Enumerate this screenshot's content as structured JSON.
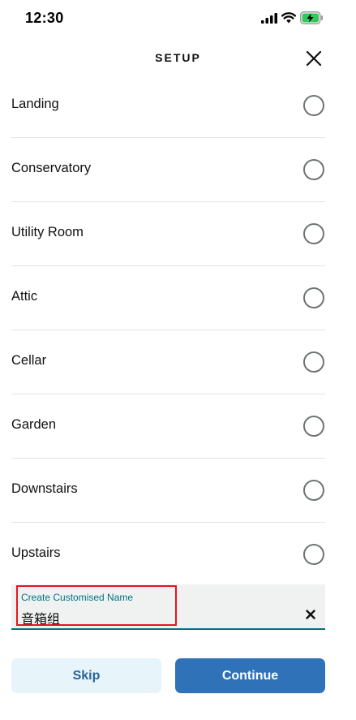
{
  "status_bar": {
    "time": "12:30",
    "icons": [
      "signal-icon",
      "wifi-icon",
      "battery-charging-icon"
    ]
  },
  "header": {
    "title": "SETUP",
    "close_icon": "close-icon"
  },
  "rooms": [
    {
      "label": "Landing",
      "selected": false
    },
    {
      "label": "Conservatory",
      "selected": false
    },
    {
      "label": "Utility Room",
      "selected": false
    },
    {
      "label": "Attic",
      "selected": false
    },
    {
      "label": "Cellar",
      "selected": false
    },
    {
      "label": "Garden",
      "selected": false
    },
    {
      "label": "Downstairs",
      "selected": false
    },
    {
      "label": "Upstairs",
      "selected": false
    }
  ],
  "custom_name": {
    "label": "Create Customised Name",
    "value": "音箱组",
    "clear_icon": "clear-icon"
  },
  "footer": {
    "skip_label": "Skip",
    "continue_label": "Continue"
  },
  "colors": {
    "accent": "#2f72b8",
    "skip_bg": "#e7f4f9",
    "field_accent": "#007185",
    "highlight": "#e4161c",
    "battery_fill": "#34c759"
  }
}
